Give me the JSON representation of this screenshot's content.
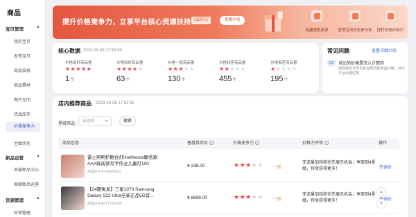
{
  "sidebar": {
    "title": "商品",
    "groups": [
      {
        "label": "宝贝管理",
        "items": [
          "我的宝贝",
          "发布宝贝",
          "商品装修",
          "商品素材",
          "图片空间",
          "货品库存",
          "价格竞争力",
          "主图优化"
        ]
      },
      {
        "label": "新品运营",
        "items": [
          "天猫新品中心",
          "国潮新品运营"
        ]
      },
      {
        "label": "货源管理",
        "items": [
          "分销管理"
        ]
      }
    ],
    "active_item": "价格竞争力"
  },
  "banner": {
    "headline": "提升价格竞争力，立享平台核心资源扶持！",
    "tag": "(试运行)",
    "button": "查看介绍",
    "features": [
      "海量搜索资源",
      "营销活动优先参与权",
      "提转化低价标识"
    ]
  },
  "core_data": {
    "title": "核心数据",
    "time": "2023-03-08 17:52:45",
    "metrics": [
      {
        "label": "价格极好商品量",
        "rating": 5,
        "value": "1",
        "unit": "个"
      },
      {
        "label": "价格较好商品量",
        "rating": 4,
        "value": "63",
        "unit": "个"
      },
      {
        "label": "价格一般商品量",
        "rating": 3,
        "value": "130",
        "unit": "个"
      },
      {
        "label": "价格较差商品量",
        "rating": 2,
        "value": "455",
        "unit": "个"
      },
      {
        "label": "价格极差商品量",
        "rating": 1,
        "value": "195",
        "unit": "个"
      }
    ]
  },
  "faq": {
    "title": "常见问题",
    "link": "查看详细介绍",
    "badge": "Q1",
    "question": "对比的价格是怎么计算的",
    "answer": "选取最近30天内的全网同款商品价格，对比平台价格优势"
  },
  "recommend": {
    "title": "店内推荐商品",
    "time": "2023-03-08 17:52:45",
    "filter_label": "星级筛选：",
    "select_placeholder": "请选择",
    "search_button": "搜索",
    "columns": [
      "商品信息",
      "普惠券后价",
      "价格竞争力",
      "价格力评估",
      "操作"
    ],
    "rows": [
      {
        "name": "雷士照明护眼台灯linefriends联名款AAA级阅读写字作业儿童灯100",
        "id": "商品id 674779673623",
        "price": "¥ 238.00",
        "rating": 3,
        "level": "一般",
        "evaluation": "无流量加持和优先展示机会；争取到4星级，将会获得更多！",
        "action": "去调价",
        "thumb_color": "#c97f6e"
      },
      {
        "name": "【24期免息】三星1070 Samsung Galaxy S22 Ultra全新正品5G官...",
        "id": "商品id 634177105234",
        "price": "¥ 8699.00",
        "rating": 3,
        "level": "一般",
        "evaluation": "无流量加持和优先展示机会；争取到4星级，将会获得更多！",
        "action": "去调价",
        "thumb_color": "#3a3a40"
      }
    ]
  },
  "colors": {
    "accent": "#3366dd",
    "star": "#e8404a",
    "banner": "#e4573f"
  }
}
